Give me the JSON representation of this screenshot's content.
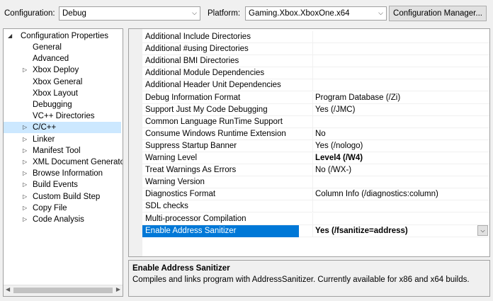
{
  "toolbar": {
    "configuration_label": "Configuration:",
    "configuration_value": "Debug",
    "platform_label": "Platform:",
    "platform_value": "Gaming.Xbox.XboxOne.x64",
    "manager_button": "Configuration Manager..."
  },
  "tree": {
    "root": "Configuration Properties",
    "items": [
      {
        "label": "General",
        "expandable": false
      },
      {
        "label": "Advanced",
        "expandable": false
      },
      {
        "label": "Xbox Deploy",
        "expandable": true
      },
      {
        "label": "Xbox General",
        "expandable": false
      },
      {
        "label": "Xbox Layout",
        "expandable": false
      },
      {
        "label": "Debugging",
        "expandable": false
      },
      {
        "label": "VC++ Directories",
        "expandable": false
      },
      {
        "label": "C/C++",
        "expandable": true,
        "selected": true
      },
      {
        "label": "Linker",
        "expandable": true
      },
      {
        "label": "Manifest Tool",
        "expandable": true
      },
      {
        "label": "XML Document Generator",
        "expandable": true
      },
      {
        "label": "Browse Information",
        "expandable": true
      },
      {
        "label": "Build Events",
        "expandable": true
      },
      {
        "label": "Custom Build Step",
        "expandable": true
      },
      {
        "label": "Copy File",
        "expandable": true
      },
      {
        "label": "Code Analysis",
        "expandable": true
      }
    ]
  },
  "properties": [
    {
      "name": "Additional Include Directories",
      "value": ""
    },
    {
      "name": "Additional #using Directories",
      "value": ""
    },
    {
      "name": "Additional BMI Directories",
      "value": ""
    },
    {
      "name": "Additional Module Dependencies",
      "value": ""
    },
    {
      "name": "Additional Header Unit Dependencies",
      "value": ""
    },
    {
      "name": "Debug Information Format",
      "value": "Program Database (/Zi)"
    },
    {
      "name": "Support Just My Code Debugging",
      "value": "Yes (/JMC)"
    },
    {
      "name": "Common Language RunTime Support",
      "value": ""
    },
    {
      "name": "Consume Windows Runtime Extension",
      "value": "No"
    },
    {
      "name": "Suppress Startup Banner",
      "value": "Yes (/nologo)"
    },
    {
      "name": "Warning Level",
      "value": "Level4 (/W4)",
      "bold": true
    },
    {
      "name": "Treat Warnings As Errors",
      "value": "No (/WX-)"
    },
    {
      "name": "Warning Version",
      "value": ""
    },
    {
      "name": "Diagnostics Format",
      "value": "Column Info (/diagnostics:column)"
    },
    {
      "name": "SDL checks",
      "value": ""
    },
    {
      "name": "Multi-processor Compilation",
      "value": ""
    },
    {
      "name": "Enable Address Sanitizer",
      "value": "Yes (/fsanitize=address)",
      "bold": true,
      "selected": true
    }
  ],
  "description": {
    "title": "Enable Address Sanitizer",
    "text": "Compiles and links program with AddressSanitizer. Currently available for x86 and x64 builds."
  },
  "colors": {
    "selection": "#0078d7",
    "tree_selection": "#cce8ff"
  }
}
